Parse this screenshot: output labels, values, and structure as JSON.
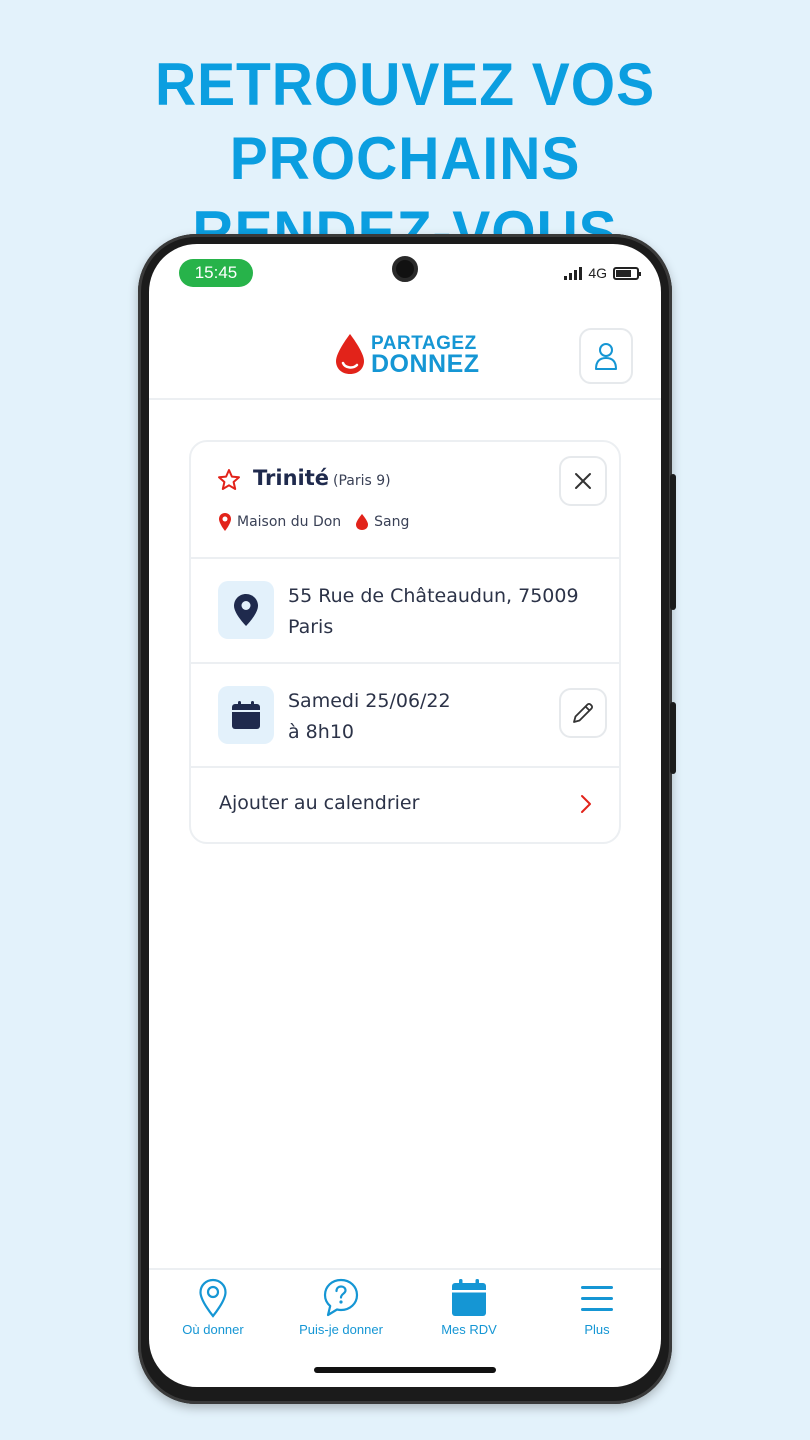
{
  "headline": {
    "line1": "RETROUVEZ VOS PROCHAINS",
    "line2": "RENDEZ-VOUS"
  },
  "status_bar": {
    "time": "15:45",
    "network": "4G"
  },
  "header": {
    "logo_line1": "PARTAGEZ",
    "logo_line2": "DONNEZ",
    "brand_color": "#1596d4",
    "drop_color": "#e2231a"
  },
  "appointment": {
    "center_name": "Trinité",
    "center_district": "(Paris 9)",
    "tags": [
      {
        "icon": "map-pin-icon",
        "label": "Maison du Don"
      },
      {
        "icon": "blood-drop-icon",
        "label": "Sang"
      }
    ],
    "address_line1": "55 Rue de Châteaudun, 75009",
    "address_line2": "Paris",
    "date_line1": "Samedi 25/06/22",
    "date_line2": "à 8h10",
    "calendar_action": "Ajouter au calendrier"
  },
  "nav": {
    "items": [
      {
        "label": "Où donner",
        "icon": "location-icon"
      },
      {
        "label": "Puis-je donner",
        "icon": "question-bubble-icon"
      },
      {
        "label": "Mes RDV",
        "icon": "calendar-icon",
        "active": true
      },
      {
        "label": "Plus",
        "icon": "menu-icon"
      }
    ]
  }
}
